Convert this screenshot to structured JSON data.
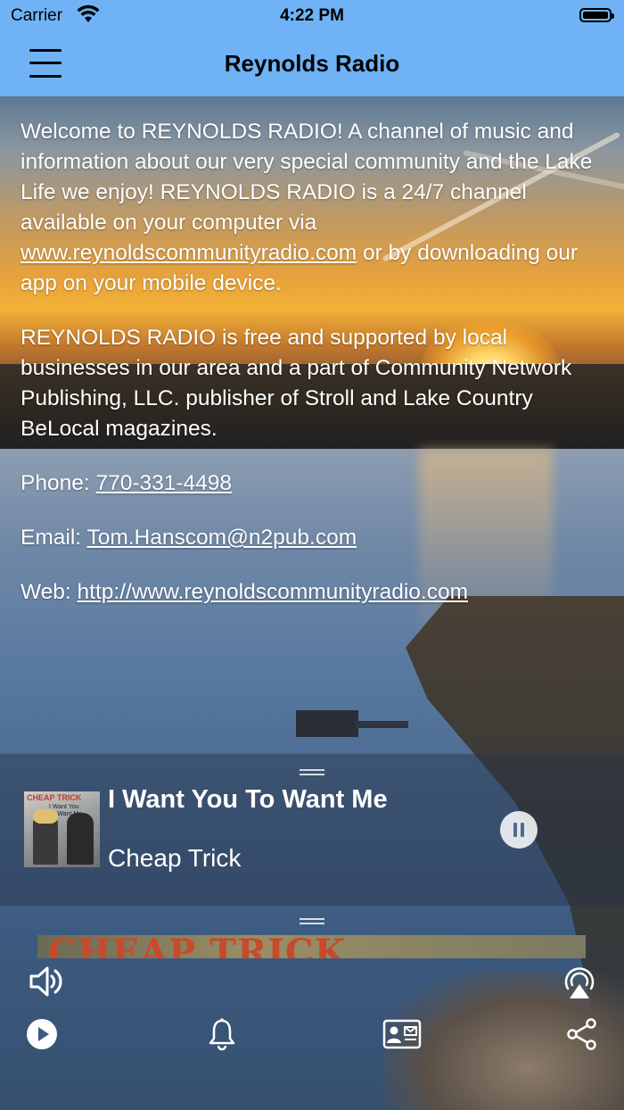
{
  "status_bar": {
    "carrier": "Carrier",
    "time": "4:22 PM",
    "icons": [
      "wifi-icon",
      "battery-icon"
    ]
  },
  "nav": {
    "title": "Reynolds Radio",
    "menu_icon": "hamburger-menu-icon"
  },
  "content": {
    "para1_text": "Welcome to REYNOLDS RADIO! A channel of music and information about our very special community and the Lake Life we enjoy! REYNOLDS RADIO is a 24/7 channel available on your computer via ",
    "para1_link": "www.reynoldscommunityradio.com",
    "para1_tail": " or by downloading our app on your mobile device.",
    "para2": "REYNOLDS RADIO is free and supported by local businesses in our area and a part of Community Network Publishing, LLC. publisher of Stroll and Lake Country BeLocal magazines.",
    "phone_label": "Phone: ",
    "phone": "770-331-4498",
    "email_label": "Email: ",
    "email": "Tom.Hanscom@n2pub.com",
    "web_label": "Web: ",
    "web": "http://www.reynoldscommunityradio.com"
  },
  "player": {
    "title": "I Want You To Want Me",
    "artist": "Cheap Trick",
    "album_band": "CHEAP TRICK",
    "album_song": "I Want You To Want Me",
    "banner_text": "CHEAP TRICK",
    "state_icon": "pause-icon"
  },
  "controls": {
    "icons": [
      "volume-icon",
      "airplay-icon",
      "play-icon",
      "bell-icon",
      "contact-card-icon",
      "share-icon"
    ]
  }
}
